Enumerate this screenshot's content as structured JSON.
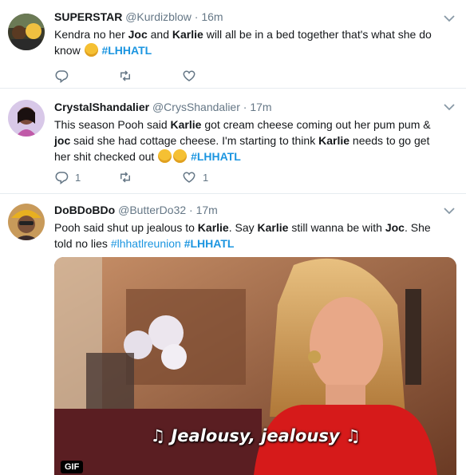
{
  "colors": {
    "link": "#1b95e0",
    "muted": "#657786",
    "text": "#14171a",
    "border": "#e6ecf0"
  },
  "tweets": [
    {
      "name": "SUPERSTAR",
      "handle": "@Kurdizblow",
      "dot": "·",
      "time": "16m",
      "segments": [
        {
          "t": "Kendra no her "
        },
        {
          "t": "Joc",
          "b": true
        },
        {
          "t": " and "
        },
        {
          "t": "Karlie",
          "b": true
        },
        {
          "t": " will all be in a bed together that's what she do know "
        },
        {
          "t": "rofl-emoji",
          "emoji": "rofl"
        },
        {
          "t": " "
        },
        {
          "t": "#LHHATL",
          "tag": true,
          "b": true
        }
      ],
      "reply_count": "",
      "retweet_count": "",
      "like_count": ""
    },
    {
      "name": "CrystalShandalier",
      "handle": "@CrysShandalier",
      "dot": "·",
      "time": "17m",
      "segments": [
        {
          "t": "This season Pooh said "
        },
        {
          "t": "Karlie",
          "b": true
        },
        {
          "t": " got cream cheese coming out her pum pum & "
        },
        {
          "t": "joc",
          "b": true
        },
        {
          "t": " said she had cottage cheese. I'm starting to think "
        },
        {
          "t": "Karlie",
          "b": true
        },
        {
          "t": " needs to go get her shit checked out "
        },
        {
          "t": "woozy-emoji",
          "emoji": "woozy"
        },
        {
          "t": "woozy-emoji",
          "emoji": "woozy"
        },
        {
          "t": " "
        },
        {
          "t": "#LHHATL",
          "tag": true,
          "b": true
        }
      ],
      "reply_count": "1",
      "retweet_count": "",
      "like_count": "1"
    },
    {
      "name": "DoBDoBDo",
      "handle": "@ButterDo32",
      "dot": "·",
      "time": "17m",
      "segments": [
        {
          "t": "Pooh said shut up jealous to "
        },
        {
          "t": "Karlie",
          "b": true
        },
        {
          "t": ". Say "
        },
        {
          "t": "Karlie",
          "b": true
        },
        {
          "t": " still wanna be with "
        },
        {
          "t": "Joc",
          "b": true
        },
        {
          "t": ".  She told no lies "
        },
        {
          "t": "#lhhatlreunion",
          "tag": true
        },
        {
          "t": " "
        },
        {
          "t": "#LHHATL",
          "tag": true,
          "b": true
        }
      ],
      "media_caption": "♫ Jealousy, jealousy ♫",
      "media_badge": "GIF"
    }
  ]
}
